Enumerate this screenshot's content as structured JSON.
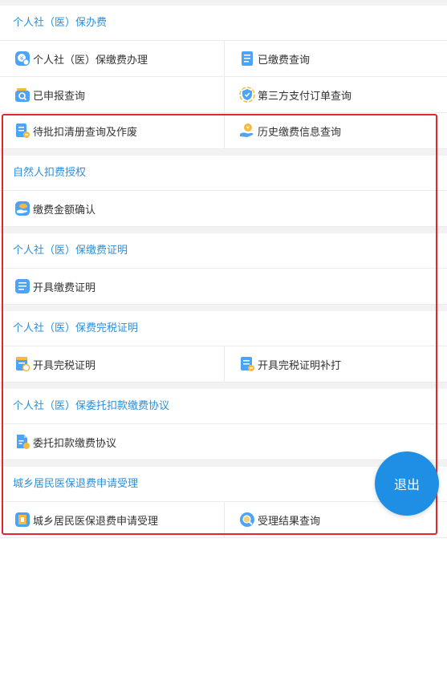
{
  "sections": [
    {
      "title": "个人社（医）保办费",
      "rows": [
        [
          {
            "label": "个人社（医）保缴费办理",
            "icon": "money-circle-icon"
          },
          {
            "label": "已缴费查询",
            "icon": "document-list-icon"
          }
        ],
        [
          {
            "label": "已申报查询",
            "icon": "search-folder-icon"
          },
          {
            "label": "第三方支付订单查询",
            "icon": "shield-check-icon"
          }
        ],
        [
          {
            "label": "待批扣清册查询及作废",
            "icon": "document-edit-icon"
          },
          {
            "label": "历史缴费信息查询",
            "icon": "coin-hand-icon"
          }
        ]
      ]
    },
    {
      "title": "自然人扣费授权",
      "rows": [
        [
          {
            "label": "缴费金额确认",
            "icon": "wallet-hand-icon"
          }
        ]
      ]
    },
    {
      "title": "个人社（医）保缴费证明",
      "rows": [
        [
          {
            "label": "开具缴费证明",
            "icon": "document-lines-icon"
          }
        ]
      ]
    },
    {
      "title": "个人社（医）保费完税证明",
      "rows": [
        [
          {
            "label": "开具完税证明",
            "icon": "document-stamp-icon"
          },
          {
            "label": "开具完税证明补打",
            "icon": "document-print-icon"
          }
        ]
      ]
    },
    {
      "title": "个人社（医）保委托扣款缴费协议",
      "rows": [
        [
          {
            "label": "委托扣款缴费协议",
            "icon": "agreement-icon"
          }
        ]
      ]
    },
    {
      "title": "城乡居民医保退费申请受理",
      "rows": [
        [
          {
            "label": "城乡居民医保退费申请受理",
            "icon": "refund-box-icon"
          },
          {
            "label": "受理结果查询",
            "icon": "magnifier-icon"
          }
        ]
      ]
    }
  ],
  "logout_label": "退出",
  "colors": {
    "section_title": "#2e8fd8",
    "highlight_border": "#e8232a",
    "logout_bg": "#1f8fe6"
  }
}
